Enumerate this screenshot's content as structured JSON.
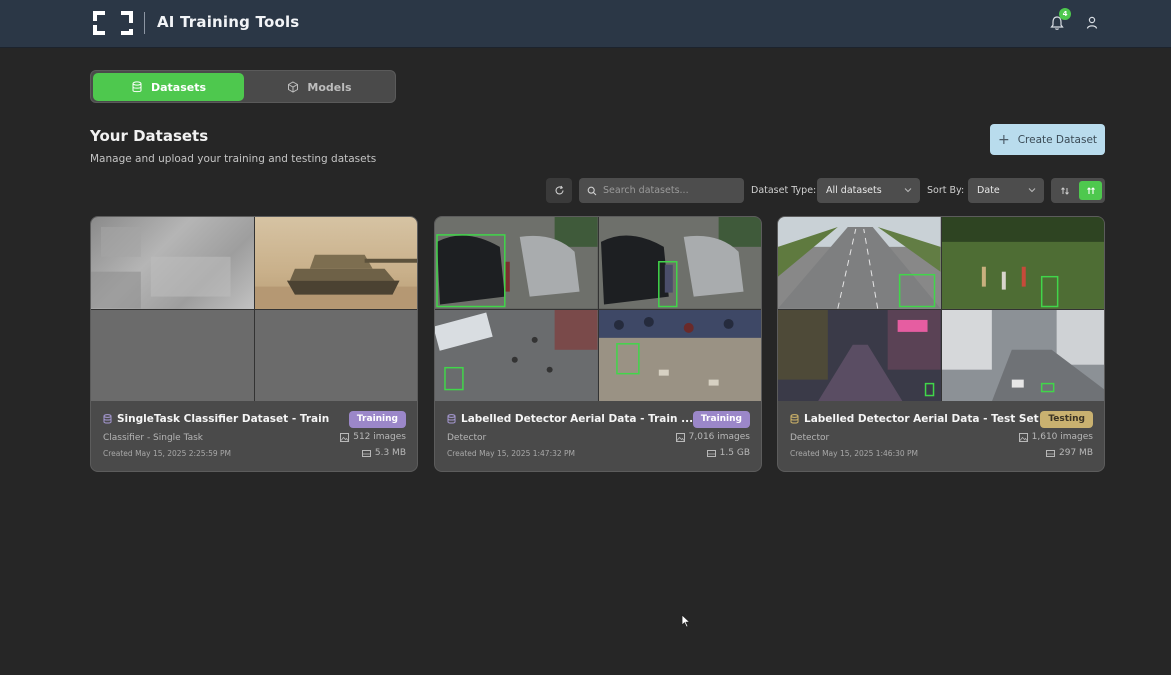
{
  "header": {
    "app_title": "AI Training Tools",
    "notification_count": "4"
  },
  "tabs": [
    {
      "label": "Datasets",
      "active": true
    },
    {
      "label": "Models",
      "active": false
    }
  ],
  "page": {
    "title": "Your Datasets",
    "subtitle": "Manage and upload your training and testing datasets",
    "create_label": "Create Dataset"
  },
  "toolbar": {
    "search_placeholder": "Search datasets...",
    "type_label": "Dataset Type:",
    "type_value": "All datasets",
    "sort_label": "Sort By:",
    "sort_value": "Date"
  },
  "datasets": [
    {
      "name": "SingleTask Classifier Dataset - Train",
      "tag": "Training",
      "type": "Classifier - Single Task",
      "created": "Created May 15, 2025 2:25:59 PM",
      "images": "512 images",
      "size": "5.3 MB"
    },
    {
      "name": "Labelled Detector Aerial Data - Train ...",
      "tag": "Training",
      "type": "Detector",
      "created": "Created May 15, 2025 1:47:32 PM",
      "images": "7,016 images",
      "size": "1.5 GB"
    },
    {
      "name": "Labelled Detector Aerial Data - Test Set",
      "tag": "Testing",
      "type": "Detector",
      "created": "Created May 15, 2025 1:46:30 PM",
      "images": "1,610 images",
      "size": "297 MB"
    }
  ],
  "colors": {
    "accent": "#4ec84e",
    "training_tag": "#9b87c9",
    "testing_tag": "#c9b170",
    "create_button": "#b9dced"
  }
}
